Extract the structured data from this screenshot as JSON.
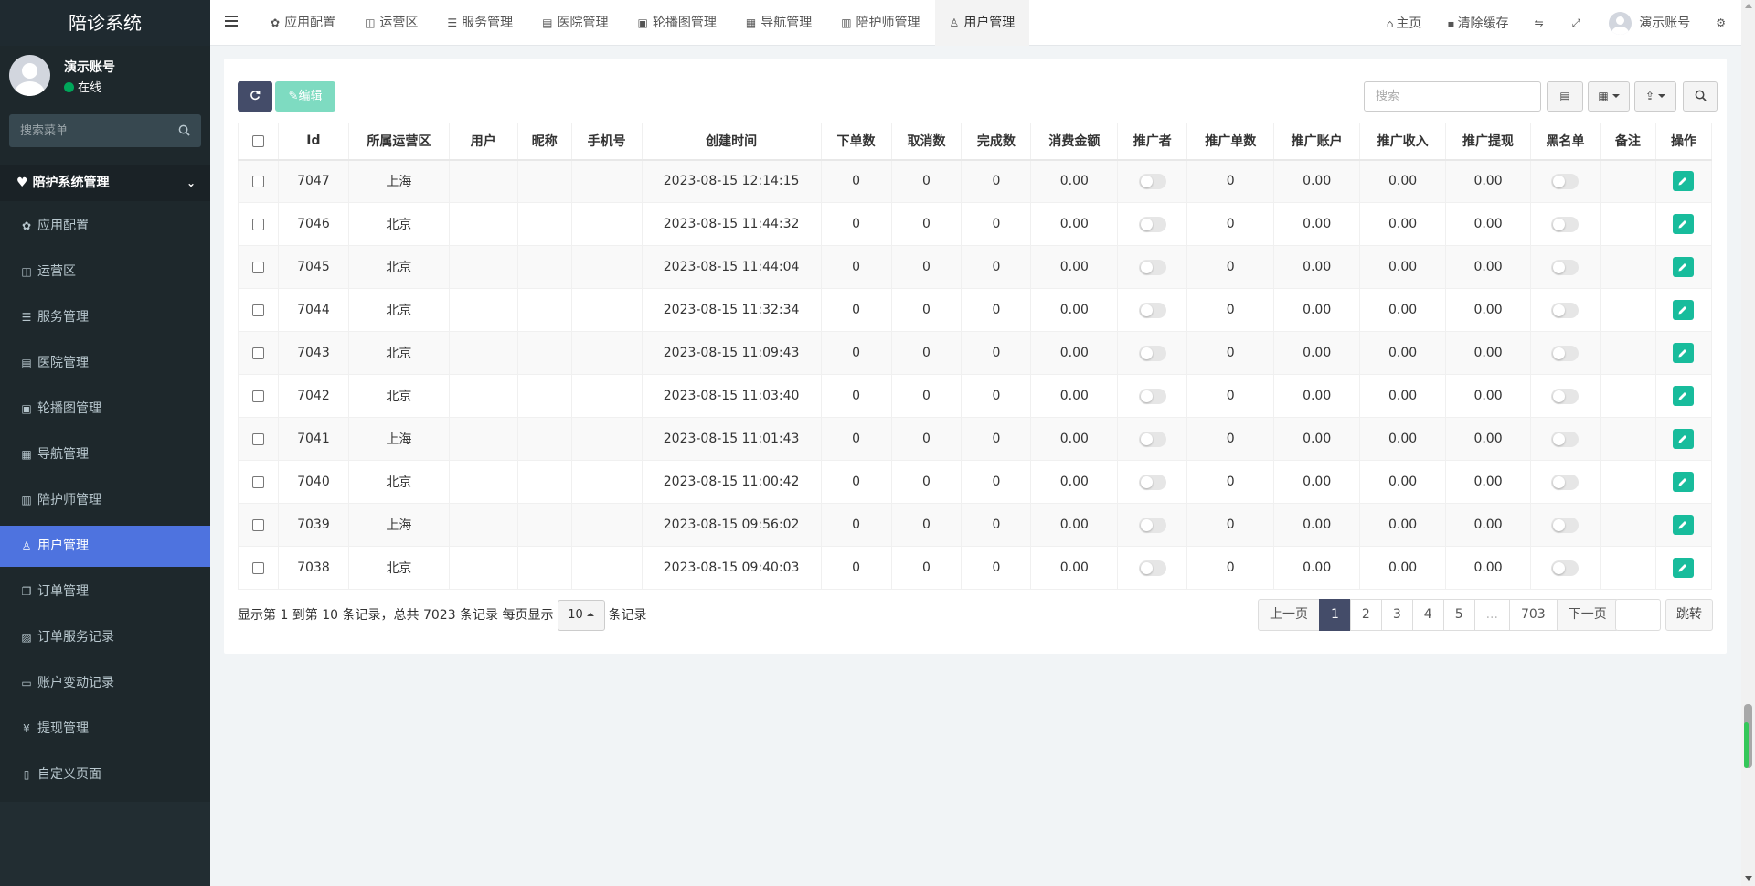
{
  "app": {
    "title": "陪诊系统"
  },
  "user": {
    "name": "演示账号",
    "status": "在线"
  },
  "sidebar": {
    "search_placeholder": "搜索菜单",
    "group_label": "陪护系统管理",
    "items": [
      {
        "label": "应用配置",
        "icon": "gear-icon"
      },
      {
        "label": "运营区",
        "icon": "map-icon"
      },
      {
        "label": "服务管理",
        "icon": "list-icon"
      },
      {
        "label": "医院管理",
        "icon": "clipboard-icon"
      },
      {
        "label": "轮播图管理",
        "icon": "image-icon"
      },
      {
        "label": "导航管理",
        "icon": "grid-icon"
      },
      {
        "label": "陪护师管理",
        "icon": "id-card-icon"
      },
      {
        "label": "用户管理",
        "icon": "user-icon",
        "active": true
      },
      {
        "label": "订单管理",
        "icon": "copy-icon"
      },
      {
        "label": "订单服务记录",
        "icon": "save-icon"
      },
      {
        "label": "账户变动记录",
        "icon": "card-icon"
      },
      {
        "label": "提现管理",
        "icon": "yen-icon"
      },
      {
        "label": "自定义页面",
        "icon": "file-icon"
      }
    ]
  },
  "header": {
    "tabs": [
      {
        "label": "应用配置",
        "icon": "gear-icon"
      },
      {
        "label": "运营区",
        "icon": "map-icon"
      },
      {
        "label": "服务管理",
        "icon": "list-icon"
      },
      {
        "label": "医院管理",
        "icon": "clipboard-icon"
      },
      {
        "label": "轮播图管理",
        "icon": "image-icon"
      },
      {
        "label": "导航管理",
        "icon": "grid-icon"
      },
      {
        "label": "陪护师管理",
        "icon": "id-card-icon"
      },
      {
        "label": "用户管理",
        "icon": "user-icon",
        "active": true
      }
    ],
    "home_label": "主页",
    "clear_cache_label": "清除缓存",
    "account_label": "演示账号"
  },
  "toolbar": {
    "edit_label": "编辑",
    "search_placeholder": "搜索"
  },
  "table": {
    "columns": [
      "Id",
      "所属运营区",
      "用户",
      "昵称",
      "手机号",
      "创建时间",
      "下单数",
      "取消数",
      "完成数",
      "消费金额",
      "推广者",
      "推广单数",
      "推广账户",
      "推广收入",
      "推广提现",
      "黑名单",
      "备注",
      "操作"
    ],
    "rows": [
      {
        "id": "7047",
        "region": "上海",
        "user": "",
        "nickname": "",
        "phone": "",
        "created": "2023-08-15 12:14:15",
        "orders": "0",
        "cancels": "0",
        "completes": "0",
        "amount": "0.00",
        "promo_count": "0",
        "promo_account": "0.00",
        "promo_income": "0.00",
        "promo_withdraw": "0.00",
        "remark": ""
      },
      {
        "id": "7046",
        "region": "北京",
        "user": "",
        "nickname": "",
        "phone": "",
        "created": "2023-08-15 11:44:32",
        "orders": "0",
        "cancels": "0",
        "completes": "0",
        "amount": "0.00",
        "promo_count": "0",
        "promo_account": "0.00",
        "promo_income": "0.00",
        "promo_withdraw": "0.00",
        "remark": ""
      },
      {
        "id": "7045",
        "region": "北京",
        "user": "",
        "nickname": "",
        "phone": "",
        "created": "2023-08-15 11:44:04",
        "orders": "0",
        "cancels": "0",
        "completes": "0",
        "amount": "0.00",
        "promo_count": "0",
        "promo_account": "0.00",
        "promo_income": "0.00",
        "promo_withdraw": "0.00",
        "remark": ""
      },
      {
        "id": "7044",
        "region": "北京",
        "user": "",
        "nickname": "",
        "phone": "",
        "created": "2023-08-15 11:32:34",
        "orders": "0",
        "cancels": "0",
        "completes": "0",
        "amount": "0.00",
        "promo_count": "0",
        "promo_account": "0.00",
        "promo_income": "0.00",
        "promo_withdraw": "0.00",
        "remark": ""
      },
      {
        "id": "7043",
        "region": "北京",
        "user": "",
        "nickname": "",
        "phone": "",
        "created": "2023-08-15 11:09:43",
        "orders": "0",
        "cancels": "0",
        "completes": "0",
        "amount": "0.00",
        "promo_count": "0",
        "promo_account": "0.00",
        "promo_income": "0.00",
        "promo_withdraw": "0.00",
        "remark": ""
      },
      {
        "id": "7042",
        "region": "北京",
        "user": "",
        "nickname": "",
        "phone": "",
        "created": "2023-08-15 11:03:40",
        "orders": "0",
        "cancels": "0",
        "completes": "0",
        "amount": "0.00",
        "promo_count": "0",
        "promo_account": "0.00",
        "promo_income": "0.00",
        "promo_withdraw": "0.00",
        "remark": ""
      },
      {
        "id": "7041",
        "region": "上海",
        "user": "",
        "nickname": "",
        "phone": "",
        "created": "2023-08-15 11:01:43",
        "orders": "0",
        "cancels": "0",
        "completes": "0",
        "amount": "0.00",
        "promo_count": "0",
        "promo_account": "0.00",
        "promo_income": "0.00",
        "promo_withdraw": "0.00",
        "remark": ""
      },
      {
        "id": "7040",
        "region": "北京",
        "user": "",
        "nickname": "",
        "phone": "",
        "created": "2023-08-15 11:00:42",
        "orders": "0",
        "cancels": "0",
        "completes": "0",
        "amount": "0.00",
        "promo_count": "0",
        "promo_account": "0.00",
        "promo_income": "0.00",
        "promo_withdraw": "0.00",
        "remark": ""
      },
      {
        "id": "7039",
        "region": "上海",
        "user": "",
        "nickname": "",
        "phone": "",
        "created": "2023-08-15 09:56:02",
        "orders": "0",
        "cancels": "0",
        "completes": "0",
        "amount": "0.00",
        "promo_count": "0",
        "promo_account": "0.00",
        "promo_income": "0.00",
        "promo_withdraw": "0.00",
        "remark": ""
      },
      {
        "id": "7038",
        "region": "北京",
        "user": "",
        "nickname": "",
        "phone": "",
        "created": "2023-08-15 09:40:03",
        "orders": "0",
        "cancels": "0",
        "completes": "0",
        "amount": "0.00",
        "promo_count": "0",
        "promo_account": "0.00",
        "promo_income": "0.00",
        "promo_withdraw": "0.00",
        "remark": ""
      }
    ]
  },
  "pagination": {
    "info": "显示第 1 到第 10 条记录，总共 7023 条记录 每页显示",
    "page_size": "10",
    "suffix": "条记录",
    "prev": "上一页",
    "next": "下一页",
    "pages": [
      "1",
      "2",
      "3",
      "4",
      "5",
      "...",
      "703"
    ],
    "current": "1",
    "jump_label": "跳转"
  },
  "colors": {
    "sidebar_bg": "#222d32",
    "active_menu": "#4e73df",
    "edit_green": "#18bc9c",
    "primary_dark": "#444c69",
    "online_green": "#00a65a"
  }
}
